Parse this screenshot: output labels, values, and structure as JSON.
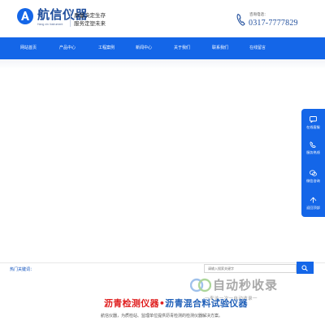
{
  "header": {
    "logo_name": "航信仪器",
    "logo_sub": "Hang xin Instrument",
    "slogan_line1": "质量决定生存",
    "slogan_line2": "服务定塑未来",
    "phone_label": "咨询电话：",
    "phone_number": "0317-7777829",
    "brand_color": "#1e4d9c"
  },
  "nav": {
    "bg_color": "#1466e8",
    "items": [
      {
        "label": "网站首页"
      },
      {
        "label": "产品中心"
      },
      {
        "label": "工程案例"
      },
      {
        "label": "新闻中心"
      },
      {
        "label": "关于我们"
      },
      {
        "label": "联系我们"
      },
      {
        "label": "在线留言"
      }
    ]
  },
  "rail": {
    "items": [
      {
        "label": "在线客服",
        "icon": "chat-icon"
      },
      {
        "label": "服务热线",
        "icon": "phone-icon"
      },
      {
        "label": "微信咨询",
        "icon": "wechat-icon"
      },
      {
        "label": "返回顶部",
        "icon": "arrow-up-icon"
      }
    ]
  },
  "search": {
    "hot_label": "热门关键词：",
    "placeholder": "请输入搜索关键字"
  },
  "headline": {
    "part1": "沥青检测仪器",
    "sep": "•",
    "part2": "沥青混合料试验仪器"
  },
  "intro": {
    "text": "航信仪器，为质检站、监理单位提供沥青检测的检测仪器解决方案。"
  },
  "watermark": {
    "text": "自动秒收录",
    "sub": "一来访一次一自动收录一"
  }
}
